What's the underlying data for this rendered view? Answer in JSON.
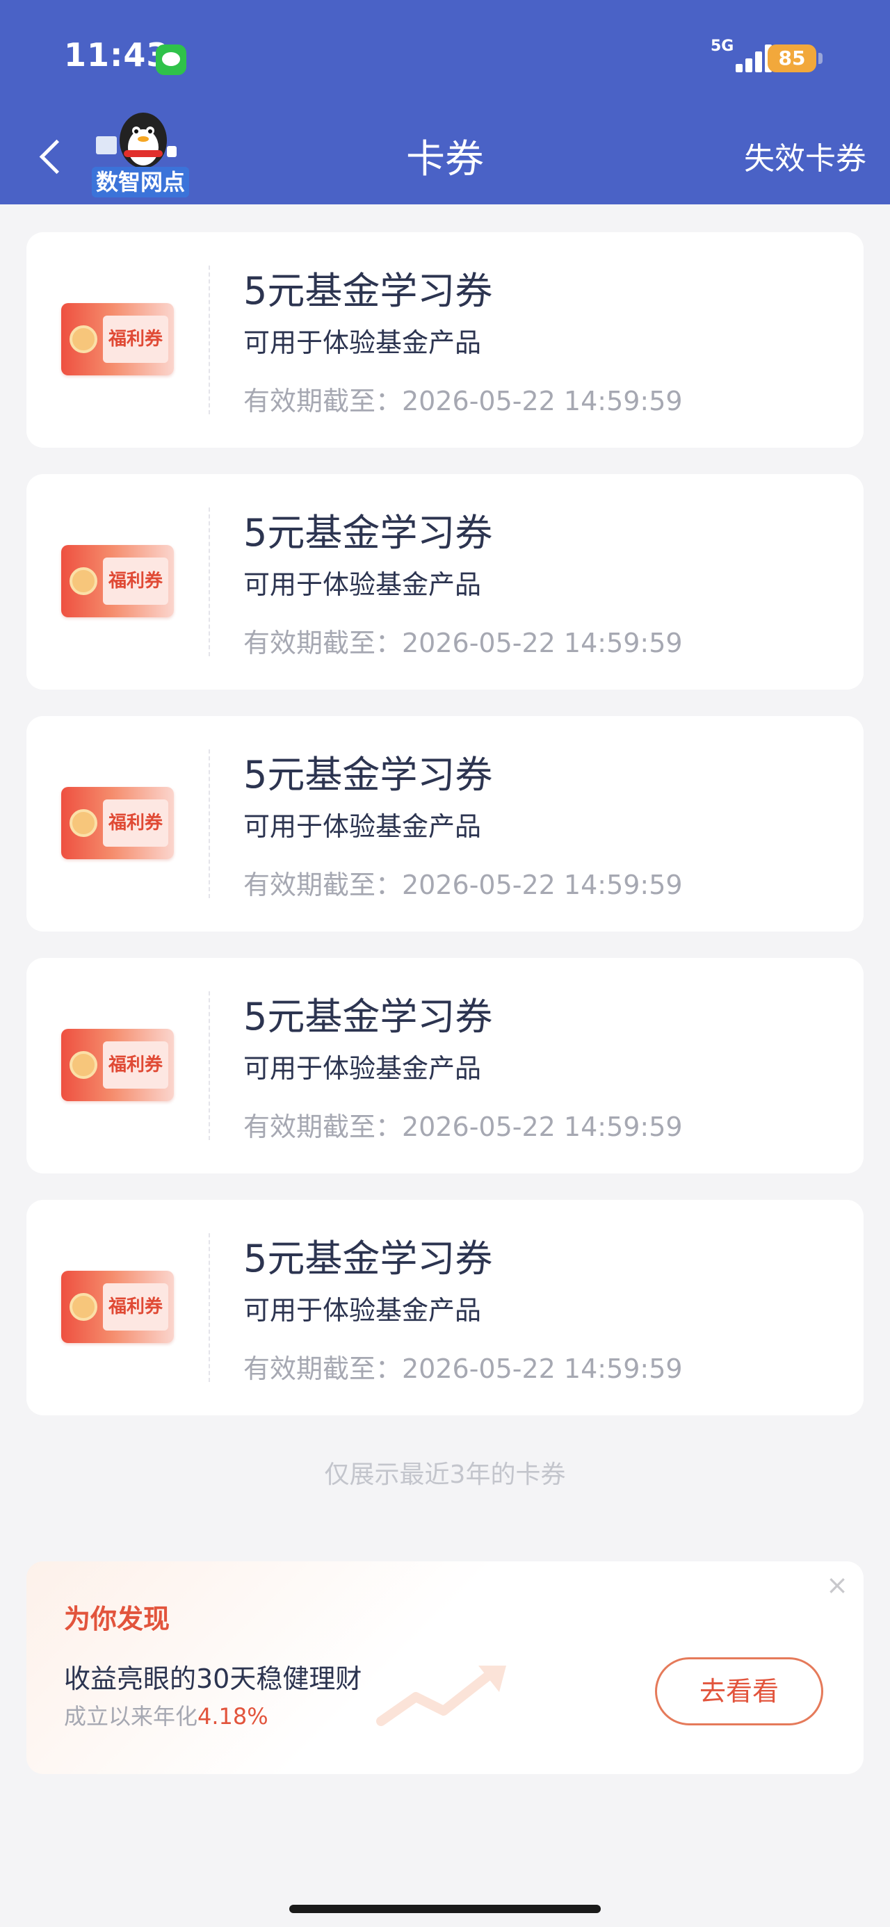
{
  "status_bar": {
    "time": "11:43",
    "network": "5G",
    "battery": "85"
  },
  "nav": {
    "mascot_label": "数智网点",
    "title": "卡券",
    "expired_link": "失效卡券"
  },
  "colors": {
    "header_bg": "#4a62c6",
    "accent": "#e2543c"
  },
  "coupons": [
    {
      "tag": "福利券",
      "title": "5元基金学习券",
      "description": "可用于体验基金产品",
      "expiry": "有效期截至：2026-05-22 14:59:59"
    },
    {
      "tag": "福利券",
      "title": "5元基金学习券",
      "description": "可用于体验基金产品",
      "expiry": "有效期截至：2026-05-22 14:59:59"
    },
    {
      "tag": "福利券",
      "title": "5元基金学习券",
      "description": "可用于体验基金产品",
      "expiry": "有效期截至：2026-05-22 14:59:59"
    },
    {
      "tag": "福利券",
      "title": "5元基金学习券",
      "description": "可用于体验基金产品",
      "expiry": "有效期截至：2026-05-22 14:59:59"
    },
    {
      "tag": "福利券",
      "title": "5元基金学习券",
      "description": "可用于体验基金产品",
      "expiry": "有效期截至：2026-05-22 14:59:59"
    }
  ],
  "footer_note": "仅展示最近3年的卡券",
  "promo": {
    "heading": "为你发现",
    "title": "收益亮眼的30天稳健理财",
    "rate_prefix": "成立以来年化",
    "rate_value": "4.18%",
    "button": "去看看",
    "close_icon": "close-icon"
  }
}
